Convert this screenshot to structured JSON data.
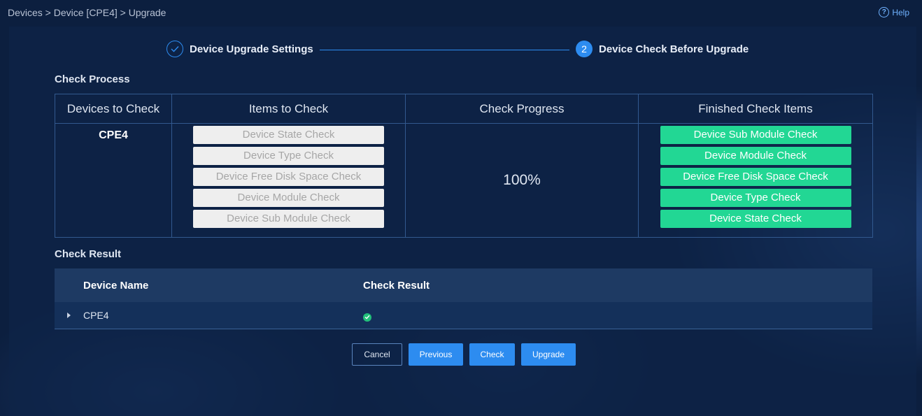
{
  "breadcrumb": "Devices > Device [CPE4] > Upgrade",
  "help": {
    "label": "Help",
    "icon": "question-circle-icon"
  },
  "steps": [
    {
      "label": "Device Upgrade Settings",
      "status": "done",
      "icon": "checkmark-icon"
    },
    {
      "number": "2",
      "label": "Device Check Before Upgrade",
      "status": "active"
    }
  ],
  "check_process": {
    "title": "Check Process",
    "headers": [
      "Devices to Check",
      "Items to Check",
      "Check Progress",
      "Finished Check Items"
    ],
    "device": "CPE4",
    "items_to_check": [
      "Device State Check",
      "Device Type Check",
      "Device Free Disk Space Check",
      "Device Module Check",
      "Device Sub Module Check"
    ],
    "progress": "100%",
    "finished_items": [
      "Device Sub Module Check",
      "Device Module Check",
      "Device Free Disk Space Check",
      "Device Type Check",
      "Device State Check"
    ]
  },
  "check_result": {
    "title": "Check Result",
    "headers": [
      "Device Name",
      "Check Result"
    ],
    "rows": [
      {
        "device": "CPE4",
        "result_icon": "check-circle-icon",
        "result_color": "#22c07a"
      }
    ]
  },
  "buttons": {
    "cancel": "Cancel",
    "previous": "Previous",
    "check": "Check",
    "upgrade": "Upgrade"
  },
  "colors": {
    "accent": "#2d8cf0",
    "success": "#22d794",
    "pending_bg": "#eeeeee"
  }
}
